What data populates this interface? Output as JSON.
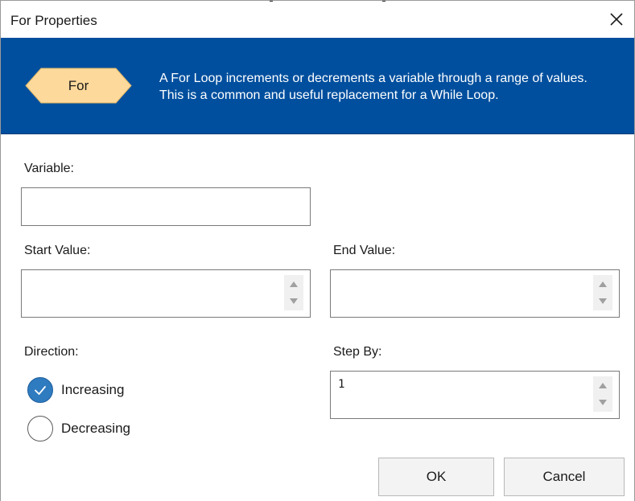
{
  "window": {
    "title": "For Properties"
  },
  "banner": {
    "shape_label": "For",
    "description": "A For Loop increments or decrements a variable through a range of values. This is a common and useful replacement for a While Loop.",
    "background_color": "#004f9e",
    "shape_color": "#fdd99b"
  },
  "form": {
    "variable": {
      "label": "Variable:",
      "value": ""
    },
    "start_value": {
      "label": "Start Value:",
      "value": ""
    },
    "end_value": {
      "label": "End Value:",
      "value": ""
    },
    "direction": {
      "label": "Direction:",
      "options": [
        {
          "label": "Increasing",
          "checked": true
        },
        {
          "label": "Decreasing",
          "checked": false
        }
      ]
    },
    "step_by": {
      "label": "Step By:",
      "value": "1"
    }
  },
  "buttons": {
    "ok_label": "OK",
    "cancel_label": "Cancel"
  },
  "icons": {
    "close": "close-icon",
    "check": "checkmark-icon",
    "spin_up": "chevron-up-icon",
    "spin_down": "chevron-down-icon"
  }
}
